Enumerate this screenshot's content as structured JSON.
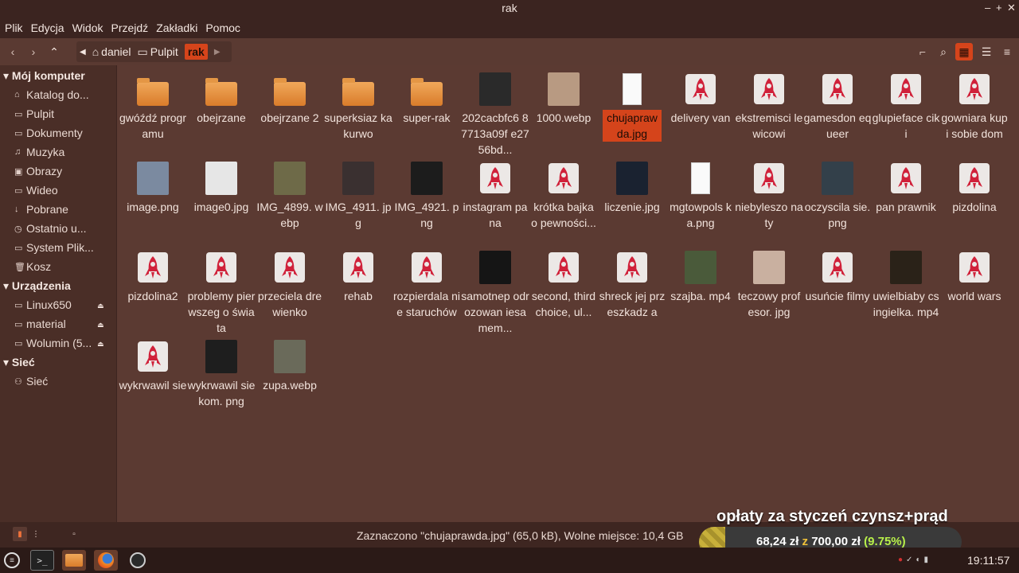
{
  "window": {
    "title": "rak"
  },
  "menubar": [
    "Plik",
    "Edycja",
    "Widok",
    "Przejdź",
    "Zakładki",
    "Pomoc"
  ],
  "breadcrumb": {
    "items": [
      "daniel",
      "Pulpit",
      "rak"
    ]
  },
  "sidebar": {
    "sections": [
      {
        "title": "Mój komputer",
        "items": [
          "Katalog do...",
          "Pulpit",
          "Dokumenty",
          "Muzyka",
          "Obrazy",
          "Wideo",
          "Pobrane",
          "Ostatnio u...",
          "System Plik...",
          "Kosz"
        ]
      },
      {
        "title": "Urządzenia",
        "items": [
          "Linux650",
          "material",
          "Wolumin (5..."
        ]
      },
      {
        "title": "Sieć",
        "items": [
          "Sieć"
        ]
      }
    ]
  },
  "files": [
    {
      "name": "gwóźdź programu",
      "kind": "folder"
    },
    {
      "name": "obejrzane",
      "kind": "folder"
    },
    {
      "name": "obejrzane 2",
      "kind": "folder"
    },
    {
      "name": "superksiaz kakurwo",
      "kind": "folder"
    },
    {
      "name": "super-rak",
      "kind": "folder"
    },
    {
      "name": "202cacbfc6 87713a09f e2756bd...",
      "kind": "photo",
      "color": "#2a2a2a"
    },
    {
      "name": "1000.webp",
      "kind": "photo",
      "color": "#b89a82"
    },
    {
      "name": "chujapraw da.jpg",
      "kind": "doc",
      "selected": true
    },
    {
      "name": "delivery van",
      "kind": "rocket"
    },
    {
      "name": "ekstremisci lewicowi",
      "kind": "rocket"
    },
    {
      "name": "gamesdon equeer",
      "kind": "rocket"
    },
    {
      "name": "glupieface ciki",
      "kind": "rocket"
    },
    {
      "name": "gowniara kupi sobie dom",
      "kind": "rocket"
    },
    {
      "name": "image.png",
      "kind": "photo",
      "color": "#7b8aa0"
    },
    {
      "name": "image0.jpg",
      "kind": "photo",
      "color": "#e6e6e6"
    },
    {
      "name": "IMG_4899. webp",
      "kind": "photo",
      "color": "#6e6a48"
    },
    {
      "name": "IMG_4911. jpg",
      "kind": "photo",
      "color": "#3a3030"
    },
    {
      "name": "IMG_4921. png",
      "kind": "photo",
      "color": "#1c1c1c"
    },
    {
      "name": "instagram pana",
      "kind": "rocket"
    },
    {
      "name": "krótka bajka o pewności...",
      "kind": "rocket"
    },
    {
      "name": "liczenie.jpg",
      "kind": "photo",
      "color": "#1a2230"
    },
    {
      "name": "mgtowpols ka.png",
      "kind": "doc"
    },
    {
      "name": "niebyleszo naty",
      "kind": "rocket"
    },
    {
      "name": "oczyscila sie.png",
      "kind": "photo",
      "color": "#33404a"
    },
    {
      "name": "pan prawnik",
      "kind": "rocket"
    },
    {
      "name": "pizdolina",
      "kind": "rocket"
    },
    {
      "name": "pizdolina2",
      "kind": "rocket"
    },
    {
      "name": "problemy pierwszeg o świata",
      "kind": "rocket"
    },
    {
      "name": "przeciela drewienko",
      "kind": "rocket"
    },
    {
      "name": "rehab",
      "kind": "rocket"
    },
    {
      "name": "rozpierdala nie staruchów",
      "kind": "rocket"
    },
    {
      "name": "samotnep odrozowan iesamem...",
      "kind": "photo",
      "color": "#151515"
    },
    {
      "name": "second, third choice, ul...",
      "kind": "rocket"
    },
    {
      "name": "shreck jej przeszkadz a",
      "kind": "rocket"
    },
    {
      "name": "szajba. mp4",
      "kind": "photo",
      "color": "#4a5a3a"
    },
    {
      "name": "teczowy profesor. jpg",
      "kind": "photo",
      "color": "#c9b0a0"
    },
    {
      "name": "usuńcie filmy",
      "kind": "rocket"
    },
    {
      "name": "uwielbiaby csingielka. mp4",
      "kind": "photo",
      "color": "#2a2218"
    },
    {
      "name": "world wars",
      "kind": "rocket"
    },
    {
      "name": "wykrwawil sie",
      "kind": "rocket"
    },
    {
      "name": "wykrwawil siekom. png",
      "kind": "photo",
      "color": "#1e1e1e"
    },
    {
      "name": "zupa.webp",
      "kind": "photo",
      "color": "#6a6a5a"
    }
  ],
  "status": {
    "text": "Zaznaczono \"chujaprawda.jpg\" (65,0 kB), Wolne miejsce: 10,4 GB"
  },
  "overlay": {
    "title": "opłaty za styczeń czynsz+prąd",
    "current": "68,24 zł",
    "sep": "z",
    "goal": "700,00 zł",
    "percent": "(9.75%)",
    "progress": 0.0975
  },
  "taskbar": {
    "clock": "19:11:57"
  },
  "colors": {
    "accent": "#d5441b",
    "background": "#5b3a32"
  }
}
